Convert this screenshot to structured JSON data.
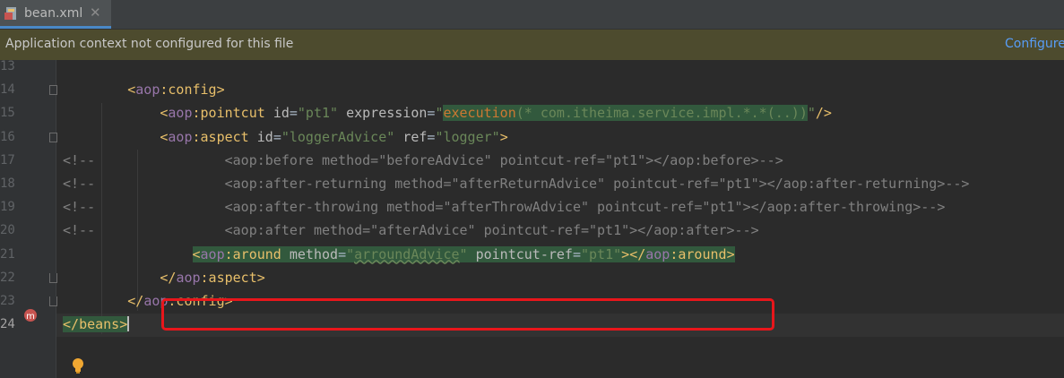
{
  "tab": {
    "file_icon": "xml-file-icon",
    "label": "bean.xml",
    "close_icon": "close-icon"
  },
  "banner": {
    "message": "Application context not configured for this file",
    "action": "Configure"
  },
  "editor": {
    "line_numbers": [
      "13",
      "14",
      "15",
      "16",
      "17",
      "18",
      "19",
      "20",
      "21",
      "22",
      "23",
      "24"
    ],
    "current_line": "24",
    "lines": [
      "",
      "        <aop:config>",
      "            <aop:pointcut id=\"pt1\" expression=\"execution(* com.itheima.service.impl.*.*(..))\"/>",
      "            <aop:aspect id=\"loggerAdvice\" ref=\"logger\">",
      "<!--                <aop:before method=\"beforeAdvice\" pointcut-ref=\"pt1\"></aop:before>-->",
      "<!--                <aop:after-returning method=\"afterReturnAdvice\" pointcut-ref=\"pt1\"></aop:after-returning>-->",
      "<!--                <aop:after-throwing method=\"afterThrowAdvice\" pointcut-ref=\"pt1\"></aop:after-throwing>-->",
      "<!--                <aop:after method=\"afterAdvice\" pointcut-ref=\"pt1\"></aop:after>-->",
      "                <aop:around method=\"arroundAdvice\" pointcut-ref=\"pt1\"></aop:around>",
      "            </aop:aspect>",
      "        </aop:config>",
      "</beans>"
    ]
  },
  "gutter_icons": {
    "line21": "spring-method-icon",
    "line23": "lightbulb-icon"
  },
  "colors": {
    "highlight_box": "#e8161b",
    "tag": "#e8bf6a",
    "namespace": "#9876aa",
    "attribute_value": "#6a8759",
    "comment": "#808080"
  }
}
